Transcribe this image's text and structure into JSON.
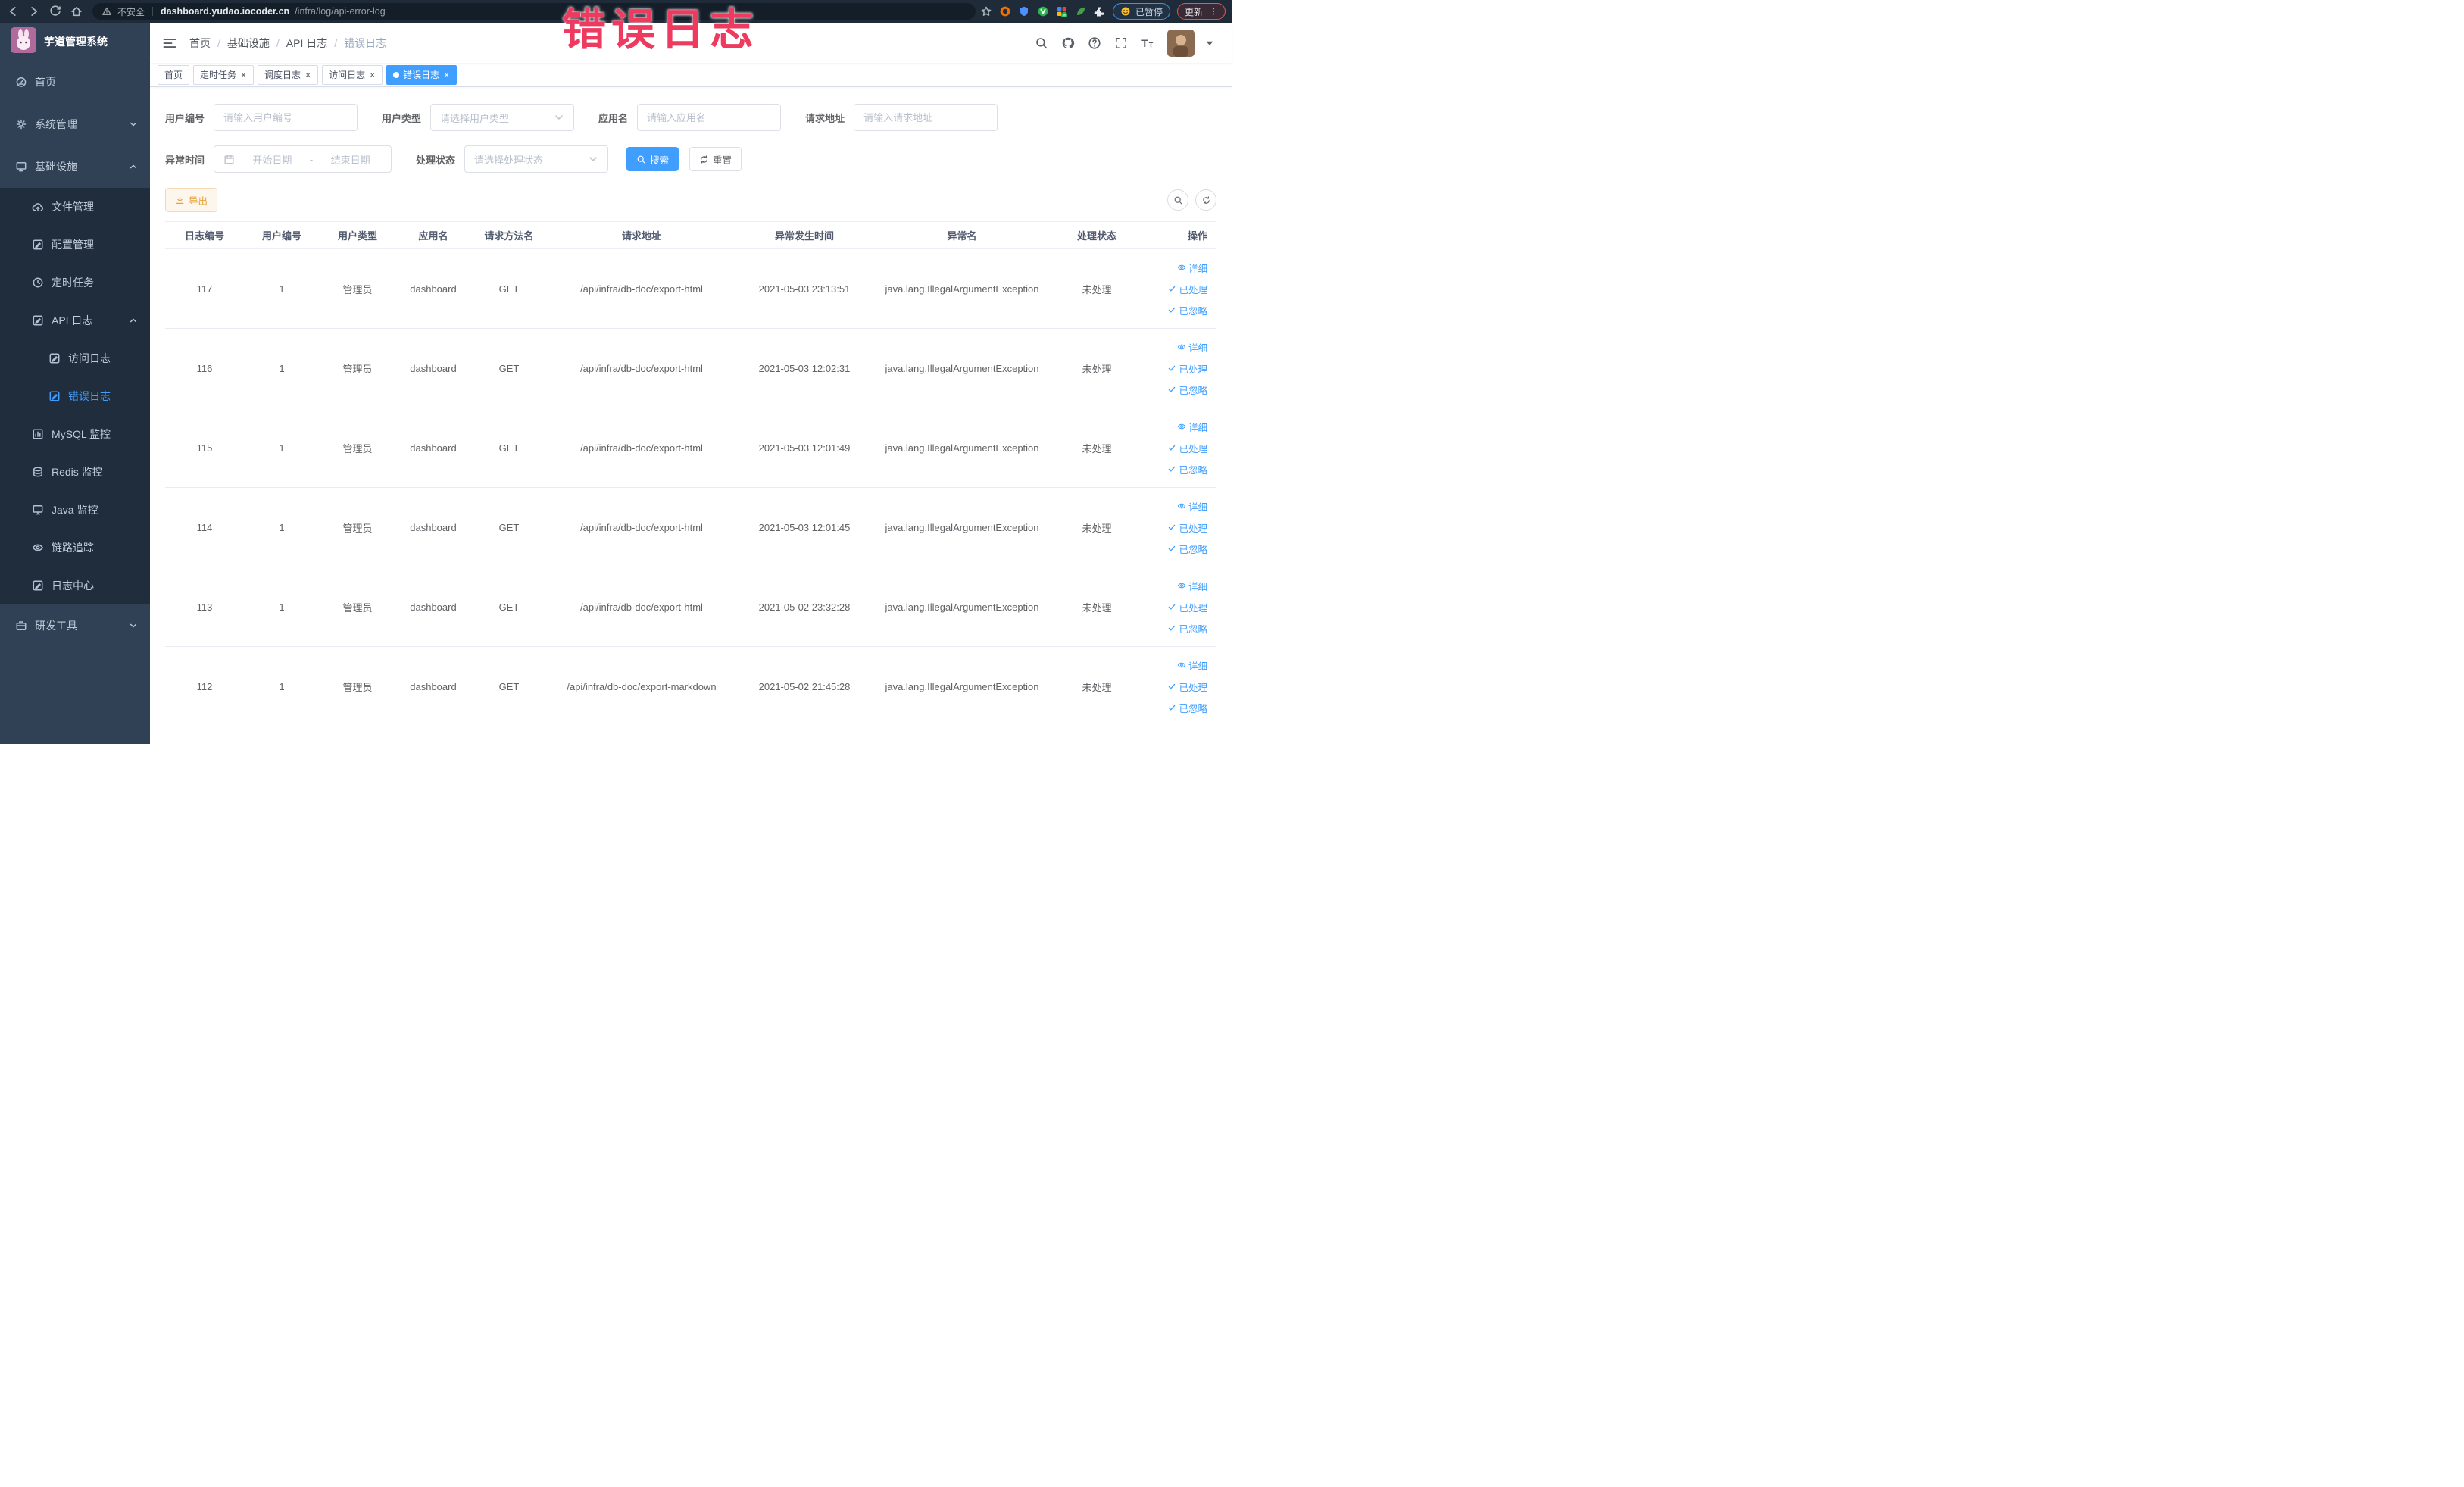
{
  "colors": {
    "accent": "#409eff",
    "warning": "#e6a23c",
    "annotation": "#ee3a5f",
    "sidebar_bg": "#304156",
    "submenu_bg": "#1f2d3d"
  },
  "annotation": {
    "text": "错误日志"
  },
  "browser": {
    "security_label": "不安全",
    "url_domain": "dashboard.yudao.iocoder.cn",
    "url_path": "/infra/log/api-error-log",
    "paused_label": "已暂停",
    "update_label": "更新"
  },
  "sidebar": {
    "title": "芋道管理系统",
    "items": [
      {
        "label": "首页",
        "icon": "dashboard",
        "level": 1
      },
      {
        "label": "系统管理",
        "icon": "gear",
        "level": 1,
        "chevron": "down"
      },
      {
        "label": "基础设施",
        "icon": "screen",
        "level": 1,
        "chevron": "up"
      },
      {
        "label": "文件管理",
        "icon": "cloud-upload",
        "level": 2
      },
      {
        "label": "配置管理",
        "icon": "edit",
        "level": 2
      },
      {
        "label": "定时任务",
        "icon": "clock",
        "level": 2
      },
      {
        "label": "API 日志",
        "icon": "log",
        "level": 2,
        "chevron": "up"
      },
      {
        "label": "访问日志",
        "icon": "log",
        "level": 3
      },
      {
        "label": "错误日志",
        "icon": "log",
        "level": 3,
        "active": true
      },
      {
        "label": "MySQL 监控",
        "icon": "chart",
        "level": 2
      },
      {
        "label": "Redis 监控",
        "icon": "database",
        "level": 2
      },
      {
        "label": "Java 监控",
        "icon": "screen",
        "level": 2
      },
      {
        "label": "链路追踪",
        "icon": "eye",
        "level": 2
      },
      {
        "label": "日志中心",
        "icon": "log",
        "level": 2
      },
      {
        "label": "研发工具",
        "icon": "briefcase",
        "level": 1,
        "chevron": "down"
      }
    ]
  },
  "breadcrumb": [
    "首页",
    "基础设施",
    "API 日志",
    "错误日志"
  ],
  "tabs": [
    {
      "label": "首页",
      "closable": false,
      "active": false
    },
    {
      "label": "定时任务",
      "closable": true,
      "active": false
    },
    {
      "label": "调度日志",
      "closable": true,
      "active": false
    },
    {
      "label": "访问日志",
      "closable": true,
      "active": false
    },
    {
      "label": "错误日志",
      "closable": true,
      "active": true
    }
  ],
  "filters": {
    "user_id": {
      "label": "用户编号",
      "placeholder": "请输入用户编号"
    },
    "user_type": {
      "label": "用户类型",
      "placeholder": "请选择用户类型"
    },
    "app_name": {
      "label": "应用名",
      "placeholder": "请输入应用名"
    },
    "request_url": {
      "label": "请求地址",
      "placeholder": "请输入请求地址"
    },
    "exception_time": {
      "label": "异常时间",
      "start_placeholder": "开始日期",
      "separator": "-",
      "end_placeholder": "结束日期"
    },
    "process_status": {
      "label": "处理状态",
      "placeholder": "请选择处理状态"
    },
    "search_label": "搜索",
    "reset_label": "重置"
  },
  "toolbar": {
    "export_label": "导出"
  },
  "table": {
    "columns": [
      "日志编号",
      "用户编号",
      "用户类型",
      "应用名",
      "请求方法名",
      "请求地址",
      "异常发生时间",
      "异常名",
      "处理状态",
      "操作"
    ],
    "actions": [
      "详细",
      "已处理",
      "已忽略"
    ],
    "rows": [
      {
        "id": "117",
        "user_id": "1",
        "user_type": "管理员",
        "app": "dashboard",
        "method": "GET",
        "url": "/api/infra/db-doc/export-html",
        "time": "2021-05-03 23:13:51",
        "exception": "java.lang.IllegalArgumentException",
        "status": "未处理"
      },
      {
        "id": "116",
        "user_id": "1",
        "user_type": "管理员",
        "app": "dashboard",
        "method": "GET",
        "url": "/api/infra/db-doc/export-html",
        "time": "2021-05-03 12:02:31",
        "exception": "java.lang.IllegalArgumentException",
        "status": "未处理"
      },
      {
        "id": "115",
        "user_id": "1",
        "user_type": "管理员",
        "app": "dashboard",
        "method": "GET",
        "url": "/api/infra/db-doc/export-html",
        "time": "2021-05-03 12:01:49",
        "exception": "java.lang.IllegalArgumentException",
        "status": "未处理"
      },
      {
        "id": "114",
        "user_id": "1",
        "user_type": "管理员",
        "app": "dashboard",
        "method": "GET",
        "url": "/api/infra/db-doc/export-html",
        "time": "2021-05-03 12:01:45",
        "exception": "java.lang.IllegalArgumentException",
        "status": "未处理"
      },
      {
        "id": "113",
        "user_id": "1",
        "user_type": "管理员",
        "app": "dashboard",
        "method": "GET",
        "url": "/api/infra/db-doc/export-html",
        "time": "2021-05-02 23:32:28",
        "exception": "java.lang.IllegalArgumentException",
        "status": "未处理"
      },
      {
        "id": "112",
        "user_id": "1",
        "user_type": "管理员",
        "app": "dashboard",
        "method": "GET",
        "url": "/api/infra/db-doc/export-markdown",
        "time": "2021-05-02 21:45:28",
        "exception": "java.lang.IllegalArgumentException",
        "status": "未处理"
      }
    ]
  }
}
